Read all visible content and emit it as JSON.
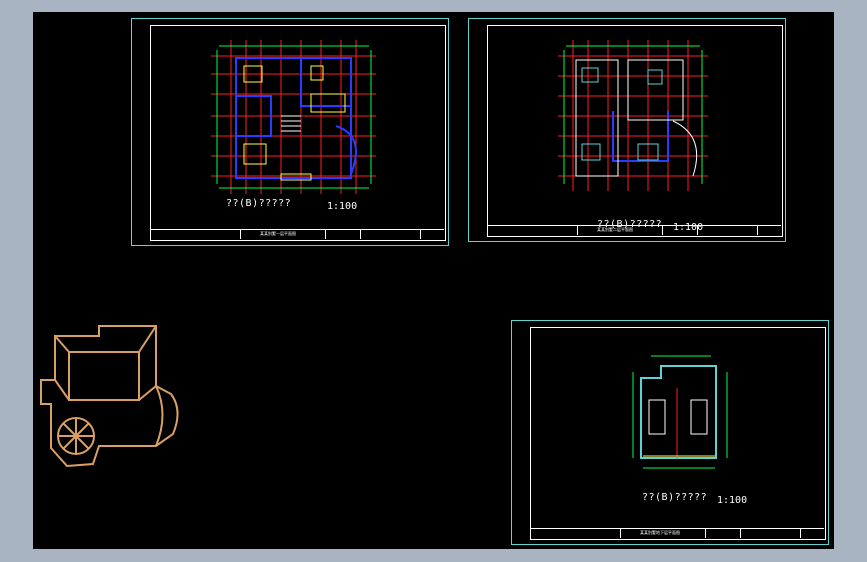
{
  "drawing_sheets": [
    {
      "id": "plan-1",
      "title": "??(B)?????",
      "scale": "1:100",
      "titleblock_label": "某某别墅一层平面图"
    },
    {
      "id": "plan-2",
      "title": "??(B)?????",
      "scale": "1:100",
      "titleblock_label": "某某别墅二层平面图"
    },
    {
      "id": "plan-3",
      "title": "??(B)?????",
      "scale": "1:100",
      "titleblock_label": "某某别墅地下层平面图"
    }
  ],
  "colors": {
    "viewport_bg": "#000000",
    "window_bg": "#a9b4c3",
    "sheet_border": "#5fd3d3",
    "axis_line": "#ff2020",
    "wall_line": "#2a3cff",
    "dimension": "#00ff40",
    "fixture_yellow": "#ffff40",
    "roof_outline": "#d9a066"
  }
}
